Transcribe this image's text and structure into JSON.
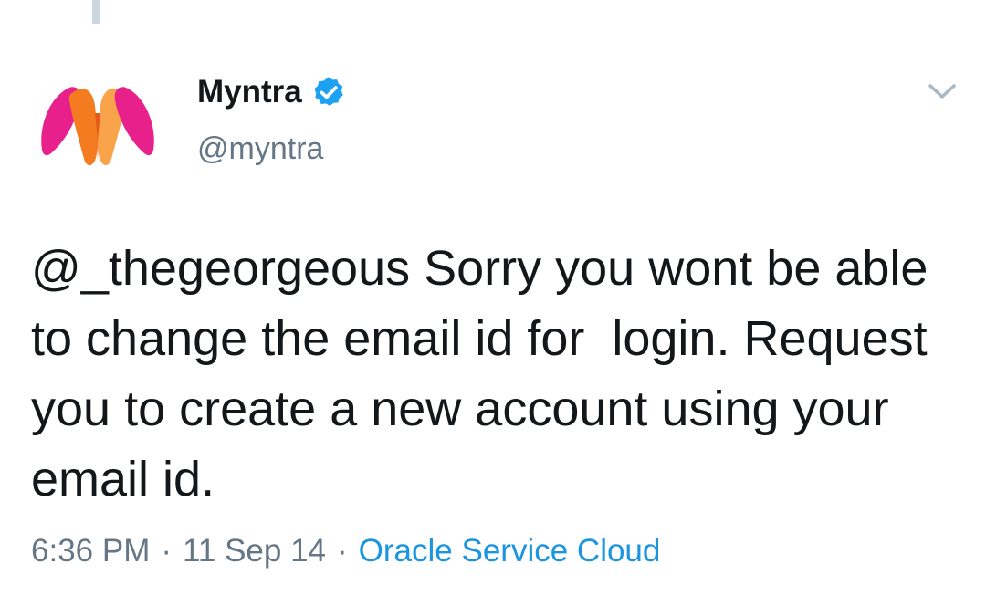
{
  "tweet": {
    "author": {
      "display_name": "Myntra",
      "handle": "@myntra",
      "verified": true,
      "avatar_icon": "myntra-logo-icon"
    },
    "text": "@_thegeorgeous Sorry you wont be able to change the email id for  login. Request you to create a new account using your email id.",
    "time": "6:36 PM",
    "date": "11 Sep 14",
    "separator": "·",
    "source": "Oracle Service Cloud",
    "menu_icon": "chevron-down-icon"
  },
  "colors": {
    "text_primary": "#14171a",
    "text_secondary": "#657786",
    "link_blue": "#1b95e0",
    "verified_blue": "#1da1f2",
    "thread_line": "#ccd6dd",
    "logo_pink": "#e8208b",
    "logo_orange": "#f47b20"
  }
}
